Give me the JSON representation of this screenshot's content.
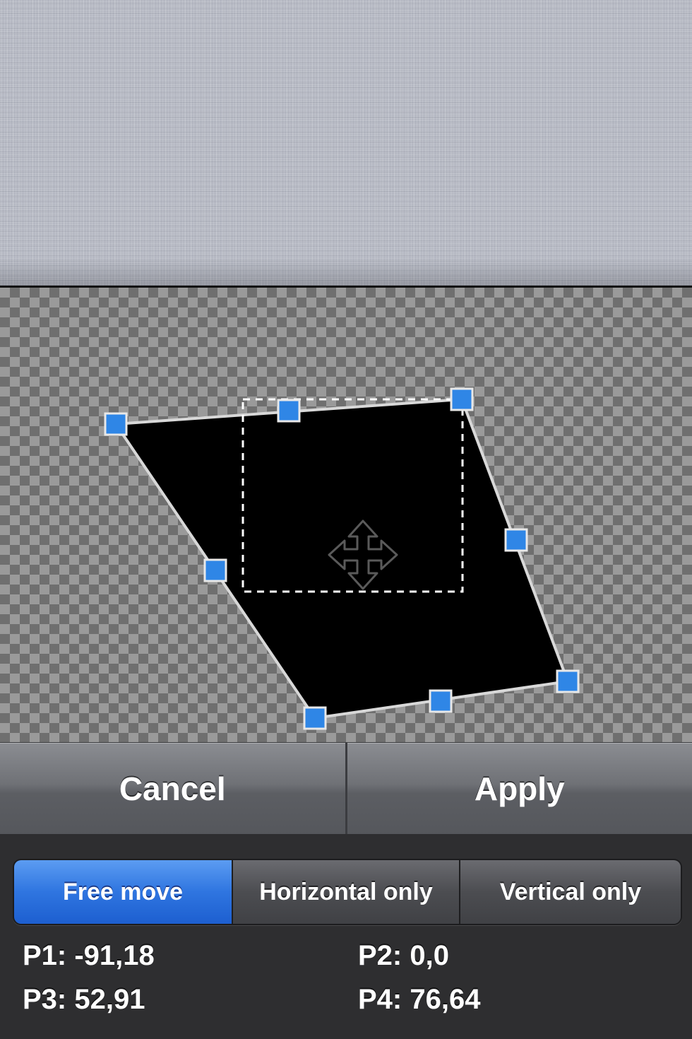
{
  "colors": {
    "handle": "#2f86e6",
    "active_segment": "#2f75e0",
    "panel_bg": "#2e2e30"
  },
  "actions": {
    "cancel_label": "Cancel",
    "apply_label": "Apply"
  },
  "modes": {
    "items": [
      {
        "label": "Free move",
        "selected": true
      },
      {
        "label": "Horizontal only",
        "selected": false
      },
      {
        "label": "Vertical only",
        "selected": false
      }
    ]
  },
  "coords": {
    "p1": "P1: -91,18",
    "p2": "P2: 0,0",
    "p3": "P3: 52,91",
    "p4": "P4: 76,64"
  },
  "icons": {
    "center": "move-arrows-icon",
    "handles": "corner-handle-icon"
  }
}
